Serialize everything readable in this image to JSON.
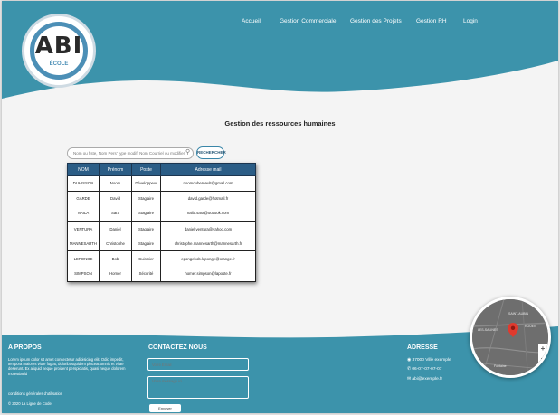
{
  "colors": {
    "brand_teal": "#3c93ab",
    "table_header": "#2b5d86",
    "search_button_border": "#3a86a8"
  },
  "logo": {
    "text": "ABI",
    "subtitle": "ÉCOLE",
    "icon": "abi-logo-icon"
  },
  "nav": {
    "items": [
      {
        "label": "Accueil"
      },
      {
        "label": "Gestion Commerciale"
      },
      {
        "label": "Gestion des Projets"
      },
      {
        "label": "Gestion RH"
      },
      {
        "label": "Login"
      }
    ]
  },
  "main": {
    "title": "Gestion des ressources humaines",
    "search": {
      "placeholder": "Nom ou fiste, Nom Pers' type modif, Nom Courriel ou modifier",
      "icon": "search-icon",
      "button_label": "RECHERCHER"
    },
    "table": {
      "headers": [
        "NOM",
        "Prénom",
        "Poste",
        "Adresse mail"
      ],
      "rows": [
        [
          "DUHISSON",
          "Noom",
          "Développeur",
          "noomdubernault@gmail.com"
        ],
        [
          "GARDE",
          "David",
          "Stagiaire",
          "david.garde@hotmail.fr"
        ],
        [
          "NAILA",
          "Sara",
          "Stagiaire",
          "naila.sara@outlook.com"
        ],
        [
          "VENTURA",
          "Daniel",
          "Stagiaire",
          "daniel.ventura@yahoo.com"
        ],
        [
          "MANNESARTH",
          "Christophe",
          "Stagiaire",
          "christophe.mannesarth@mannesarth.fr"
        ],
        [
          "LEPONGE",
          "Bob",
          "Cuisinier",
          "epongebob.leponge@orange.fr"
        ],
        [
          "SIMPSON",
          "Homer",
          "Sécurité",
          "homer.simpson@laposte.fr"
        ]
      ]
    }
  },
  "footer": {
    "about": {
      "title": "A PROPOS",
      "text": "Lorem ipsum dolor sit amet consectetur adipisicing elit. Odio impedit, tempora maiores vitae fugiat, doloribusquidem placeat omnis et vitae deserunt. Ex aliquid neque proident perspiciatis, quasi neque dolorem molestiaeld",
      "terms": "conditions générales d'utilisation",
      "copyright": "© 2020 La Ligne de Code"
    },
    "contact": {
      "title": "CONTACTEZ NOUS",
      "email_placeholder": "Votre Email",
      "message_placeholder": "Votre message ici...",
      "send_label": "Envoyer"
    },
    "address": {
      "title": "ADRESSE",
      "location": "37000 Ville exemple",
      "location_icon": "location-pin-icon",
      "phone": "06-07-07-07-07",
      "phone_icon": "phone-icon",
      "email": "abi@exemple.fr",
      "email_icon": "envelope-icon"
    },
    "map": {
      "icon": "map-marker-icon",
      "zoom_in": "+",
      "zoom_out": "−",
      "labels": [
        "SAINT-AUBIN",
        "LES-SALINES",
        "ROUEN",
        "Fontaine"
      ]
    }
  }
}
